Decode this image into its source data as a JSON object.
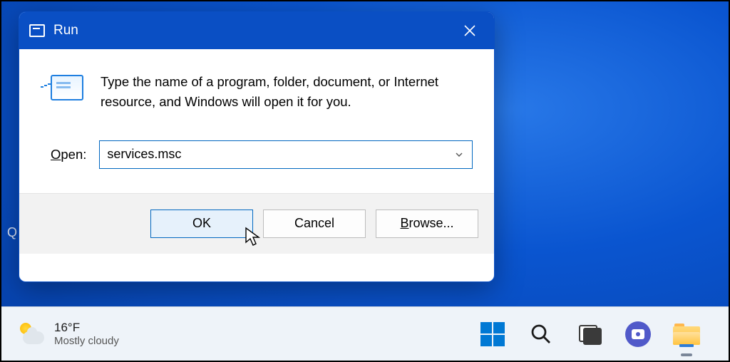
{
  "dialog": {
    "title": "Run",
    "description": "Type the name of a program, folder, document, or Internet resource, and Windows will open it for you.",
    "open_label_pre": "O",
    "open_label_post": "pen:",
    "input_value": "services.msc",
    "buttons": {
      "ok": "OK",
      "cancel": "Cancel",
      "browse_pre": "B",
      "browse_post": "rowse..."
    }
  },
  "taskbar": {
    "weather": {
      "temp": "16°F",
      "condition": "Mostly cloudy"
    }
  },
  "misc": {
    "q": "Q"
  }
}
